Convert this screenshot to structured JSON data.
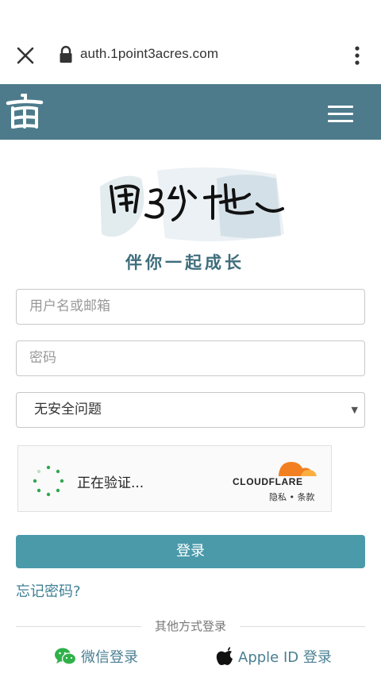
{
  "browser": {
    "url": "auth.1point3acres.com",
    "icons": {
      "close": "close-icon",
      "lock": "lock-icon",
      "menu": "more-vert-icon"
    }
  },
  "header": {
    "logo_icon": "site-logo-icon",
    "menu_icon": "hamburger-icon",
    "bg_color": "#4d7b8b"
  },
  "brand": {
    "logo_text": "亩3分地",
    "tagline": "伴你一起成长"
  },
  "form": {
    "username_placeholder": "用户名或邮箱",
    "password_placeholder": "密码",
    "security_question": "无安全问题"
  },
  "captcha": {
    "status": "正在验证...",
    "provider": "CLOUDFLARE",
    "links": "隐私 • 条款"
  },
  "actions": {
    "login_label": "登录",
    "login_color": "#4a9aaa",
    "forgot_label": "忘记密码?",
    "other_methods": "其他方式登录",
    "wechat_label": "微信登录",
    "apple_label": "Apple ID 登录"
  }
}
